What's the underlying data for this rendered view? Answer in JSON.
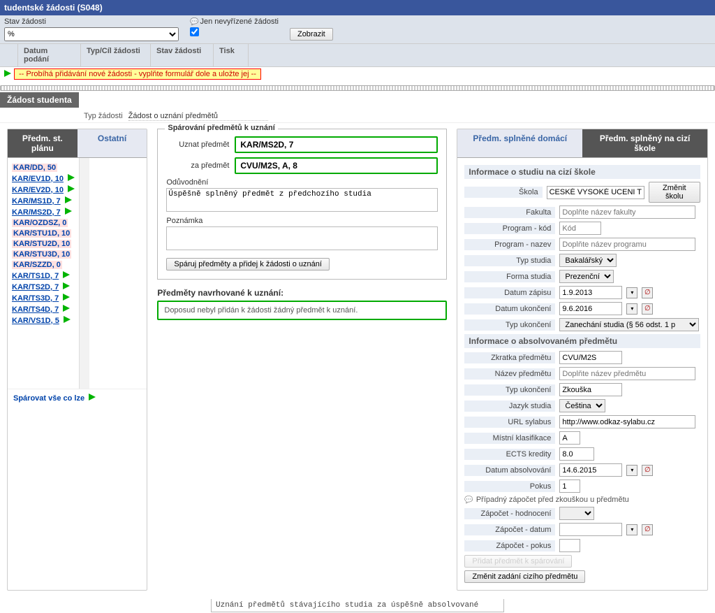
{
  "title": "tudentské žádosti (S048)",
  "filter": {
    "state_label": "Stav žádosti",
    "state_value": "%",
    "only_open_label": "Jen nevyřízené žádosti",
    "only_open_checked": true,
    "show_button": "Zobrazit"
  },
  "grid": {
    "col_spacer": "",
    "col_date": "Datum podání",
    "col_type": "Typ/Cíl žádosti",
    "col_state": "Stav žádosti",
    "col_print": "Tisk",
    "warning": "-- Probíhá přidávání nové žádosti - vyplňte formulář dole a uložte jej --"
  },
  "section_tab": "Žádost studenta",
  "type_row": {
    "label": "Typ žádosti",
    "value": "Žádost o uznání předmětů"
  },
  "left_tabs": {
    "plan": "Předm. st. plánu",
    "other": "Ostatní"
  },
  "courses": [
    {
      "code": "KAR/DD, 50",
      "arrow": false
    },
    {
      "code": "KAR/EV1D, 10",
      "arrow": true
    },
    {
      "code": "KAR/EV2D, 10",
      "arrow": true
    },
    {
      "code": "KAR/MS1D, 7",
      "arrow": true
    },
    {
      "code": "KAR/MS2D, 7",
      "arrow": true
    },
    {
      "code": "KAR/OZDSZ, 0",
      "arrow": false
    },
    {
      "code": "KAR/STU1D, 10",
      "arrow": false
    },
    {
      "code": "KAR/STU2D, 10",
      "arrow": false
    },
    {
      "code": "KAR/STU3D, 10",
      "arrow": false
    },
    {
      "code": "KAR/SZZD, 0",
      "arrow": false
    },
    {
      "code": "KAR/TS1D, 7",
      "arrow": true
    },
    {
      "code": "KAR/TS2D, 7",
      "arrow": true
    },
    {
      "code": "KAR/TS3D, 7",
      "arrow": true
    },
    {
      "code": "KAR/TS4D, 7",
      "arrow": true
    },
    {
      "code": "KAR/VS1D, 5",
      "arrow": true
    }
  ],
  "pair_all": "Spárovat vše co lze",
  "pairing": {
    "legend": "Spárování předmětů k uznání",
    "recognize_label": "Uznat předmět",
    "recognize_value": "KAR/MS2D, 7",
    "for_label": "za předmět",
    "for_value": "CVU/M2S, A, 8",
    "justification_label": "Odůvodnění",
    "justification_value": "Úspěšně splněný předmět z předchozího studia",
    "note_label": "Poznámka",
    "note_value": "",
    "pair_button": "Spáruj předměty a přidej k žádosti o uznání"
  },
  "proposed": {
    "heading": "Předměty navrhované k uznání:",
    "empty": "Doposud nebyl přidán k žádosti žádný předmět k uznání."
  },
  "right_tabs": {
    "home": "Předm. splněné domácí",
    "foreign": "Předm. splněný na cizí škole"
  },
  "study_info": {
    "heading": "Informace o studiu na cizí škole",
    "school_label": "Škola",
    "school_value": "CESKÉ VYSOKÉ UCENI TE",
    "change_school_btn": "Změnit školu",
    "faculty_label": "Fakulta",
    "faculty_ph": "Doplňte název fakulty",
    "program_code_label": "Program - kód",
    "program_code_ph": "Kód",
    "program_name_label": "Program - nazev",
    "program_name_ph": "Doplňte název programu",
    "study_type_label": "Typ studia",
    "study_type_value": "Bakalářský",
    "study_form_label": "Forma studia",
    "study_form_value": "Prezenční",
    "enroll_date_label": "Datum zápisu",
    "enroll_date_value": "1.9.2013",
    "end_date_label": "Datum ukončení",
    "end_date_value": "9.6.2016",
    "end_type_label": "Typ ukončení",
    "end_type_value": "Zanechání studia (§ 56 odst. 1 p"
  },
  "subject_info": {
    "heading": "Informace o absolvovaném předmětu",
    "abbr_label": "Zkratka předmětu",
    "abbr_value": "CVU/M2S",
    "name_label": "Název předmětu",
    "name_ph": "Doplňte název předmětu",
    "end_type_label": "Typ ukončení",
    "end_type_value": "Zkouška",
    "lang_label": "Jazyk studia",
    "lang_value": "Čeština",
    "url_label": "URL sylabus",
    "url_value": "http://www.odkaz-sylabu.cz",
    "grade_label": "Místní klasifikace",
    "grade_value": "A",
    "ects_label": "ECTS kredity",
    "ects_value": "8.0",
    "grad_date_label": "Datum absolvování",
    "grad_date_value": "14.6.2015",
    "attempt_label": "Pokus",
    "attempt_value": "1",
    "credit_heading": "Případný zápočet před zkouškou u předmětu",
    "credit_grade_label": "Zápočet - hodnocení",
    "credit_date_label": "Zápočet - datum",
    "credit_attempt_label": "Zápočet - pokus",
    "add_pair_btn": "Přidat předmět k spárování",
    "change_foreign_btn": "Změnit zadání cizího předmětu"
  },
  "bottom_note": "Uznání předmětů stávajícího studia za úspěšně absolvované"
}
